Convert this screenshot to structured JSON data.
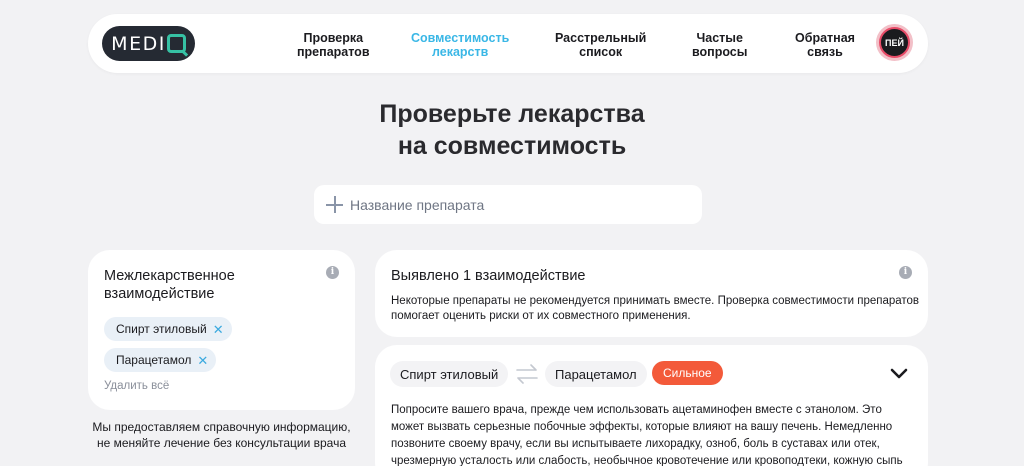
{
  "header": {
    "logo": {
      "text": "MEDI",
      "letter": "Q"
    },
    "nav": [
      {
        "line1": "Проверка",
        "line2": "препаратов"
      },
      {
        "line1": "Совместимость",
        "line2": "лекарств"
      },
      {
        "line1": "Расстрельный",
        "line2": "список"
      },
      {
        "line1": "Частые",
        "line2": "вопросы"
      },
      {
        "line1": "Обратная",
        "line2": "связь"
      }
    ],
    "avatar_text": "ПЕЙ"
  },
  "title": {
    "line1": "Проверьте лекарства",
    "line2": "на совместимость"
  },
  "search": {
    "placeholder": "Название препарата"
  },
  "selected_panel": {
    "title_line1": "Межлекарственное",
    "title_line2": "взаимодействие",
    "chips": [
      {
        "label": "Спирт этиловый"
      },
      {
        "label": "Парацетамол"
      }
    ],
    "delete_all": "Удалить всё",
    "info_icon": "i"
  },
  "disclaimer": {
    "line1": "Мы предоставляем справочную информацию,",
    "line2": "не меняйте лечение без консультации врача"
  },
  "summary": {
    "title": "Выявлено 1 взаимодействие",
    "text": "Некоторые препараты не рекомендуется принимать вместе. Проверка совместимости препаратов помогает оценить риски от их совместного применения.",
    "info_icon": "i"
  },
  "interaction": {
    "drug_a": "Спирт этиловый",
    "drug_b": "Парацетамол",
    "severity": "Сильное",
    "text": "Попросите вашего врача, прежде чем использовать ацетаминофен вместе с этанолом. Это может вызвать серьезные побочные эффекты, которые влияют на вашу печень. Немедленно позвоните своему врачу, если вы испытываете лихорадку, озноб, боль в суставах или отек, чрезмерную усталость или слабость, необычное кровотечение или кровоподтеки, кожную сыпь или зуд,"
  },
  "colors": {
    "accent": "#3ab7e6",
    "severity": "#f35a3a",
    "chip_bg": "#e9f0f7",
    "logo_bg": "#252a33",
    "logo_accent": "#36c1a4"
  }
}
